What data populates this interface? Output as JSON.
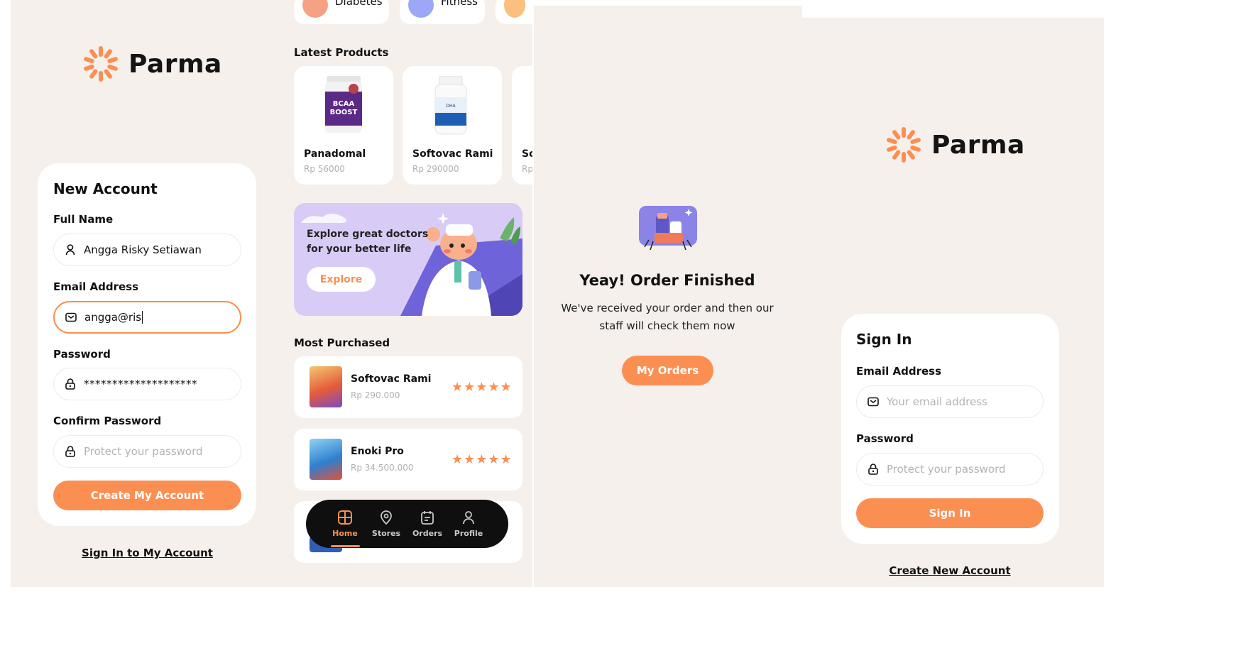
{
  "brand": {
    "name": "Parma",
    "accent": "#fb8f52"
  },
  "signup": {
    "title": "New Account",
    "full_name_label": "Full Name",
    "full_name_value": "Angga Risky Setiawan",
    "email_label": "Email Address",
    "email_value": "angga@ris",
    "password_label": "Password",
    "password_value": "********************",
    "confirm_label": "Confirm Password",
    "confirm_placeholder": "Protect your password",
    "submit_label": "Create My Account",
    "signin_link": "Sign In to My Account"
  },
  "home": {
    "categories": [
      {
        "label": "Diabetes",
        "color": "#f7a184",
        "icon": "pill-icon"
      },
      {
        "label": "Fitness",
        "color": "#9aa8f5",
        "icon": "dumbbell-icon"
      },
      {
        "label": "",
        "color": "#fbbf7e",
        "icon": "category-icon"
      }
    ],
    "latest_title": "Latest Products",
    "products": [
      {
        "name": "Panadomal",
        "price": "Rp 56000"
      },
      {
        "name": "Softovac Rami",
        "price": "Rp 290000"
      },
      {
        "name": "So",
        "price": "Rp"
      }
    ],
    "banner": {
      "text": "Explore great doctors for your better life",
      "button": "Explore"
    },
    "most_title": "Most Purchased",
    "most_purchased": [
      {
        "name": "Softovac Rami",
        "price": "Rp 290.000",
        "rating": "★★★★★"
      },
      {
        "name": "Enoki Pro",
        "price": "Rp 34.500.000",
        "rating": "★★★★★"
      }
    ],
    "nav": [
      {
        "label": "Home",
        "icon": "home-icon",
        "active": true
      },
      {
        "label": "Stores",
        "icon": "location-pin-icon"
      },
      {
        "label": "Orders",
        "icon": "calendar-icon"
      },
      {
        "label": "Profile",
        "icon": "user-icon"
      }
    ]
  },
  "order": {
    "title": "Yeay! Order Finished",
    "description": "We've received your order and then our staff will check them now",
    "button": "My Orders"
  },
  "signin": {
    "title": "Sign In",
    "email_label": "Email Address",
    "email_placeholder": "Your email address",
    "password_label": "Password",
    "password_placeholder": "Protect your password",
    "submit_label": "Sign In",
    "create_link": "Create New Account"
  }
}
